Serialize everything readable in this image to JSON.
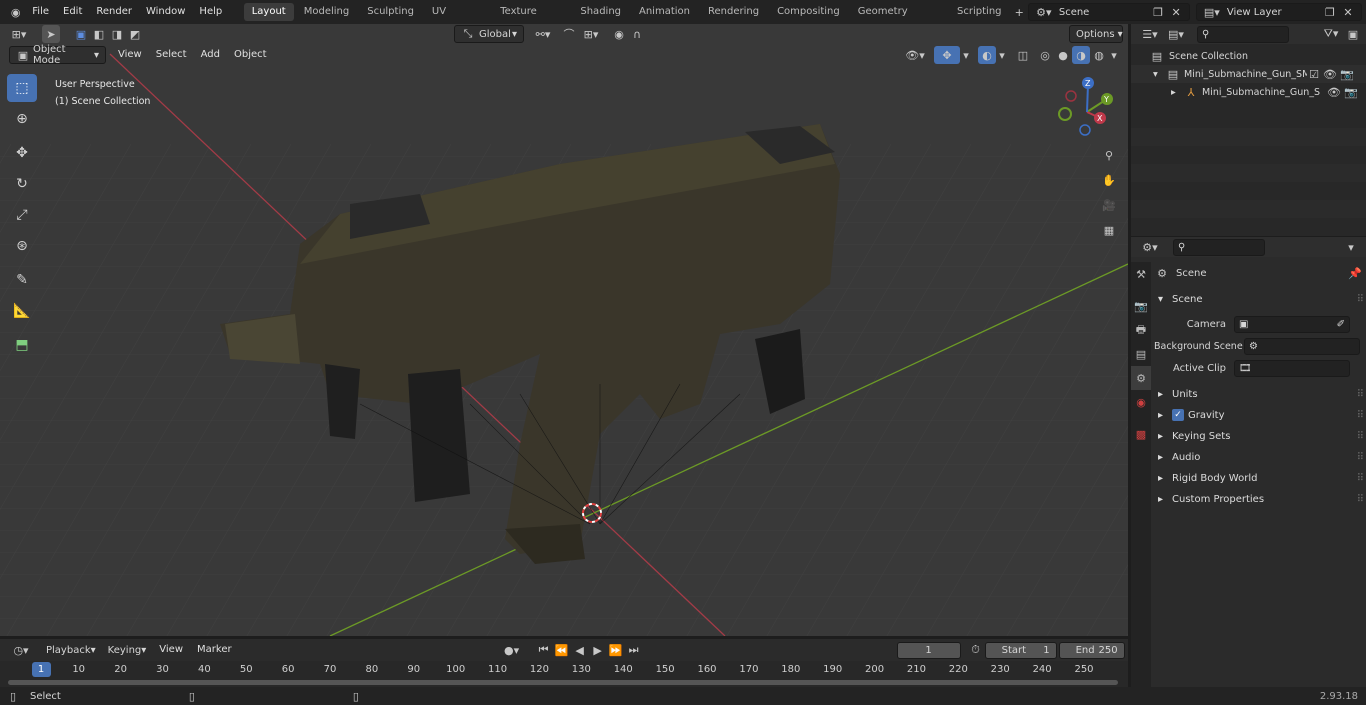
{
  "app": {
    "version": "2.93.18"
  },
  "menus": [
    "File",
    "Edit",
    "Render",
    "Window",
    "Help"
  ],
  "workspaces": [
    "Layout",
    "Modeling",
    "Sculpting",
    "UV Editing",
    "Texture Paint",
    "Shading",
    "Animation",
    "Rendering",
    "Compositing",
    "Geometry Nodes",
    "Scripting"
  ],
  "active_workspace": "Layout",
  "scene_selector": "Scene",
  "view_layer": "View Layer",
  "viewport_header": {
    "mode": "Object Mode",
    "menus": [
      "View",
      "Select",
      "Add",
      "Object"
    ],
    "transform_orientation": "Global",
    "options": "Options"
  },
  "viewport": {
    "perspective": "User Perspective",
    "collection": "(1) Scene Collection"
  },
  "gizmo": {
    "x": "X",
    "y": "Y",
    "z": "Z"
  },
  "outliner": {
    "root": "Scene Collection",
    "items": [
      {
        "label": "Mini_Submachine_Gun_SMG_S"
      },
      {
        "label": "Mini_Submachine_Gun_S"
      }
    ]
  },
  "properties": {
    "title": "Scene",
    "section": "Scene",
    "fields": [
      {
        "label": "Camera"
      },
      {
        "label": "Background Scene"
      },
      {
        "label": "Active Clip"
      }
    ],
    "panels": [
      "Units",
      "Gravity",
      "Keying Sets",
      "Audio",
      "Rigid Body World",
      "Custom Properties"
    ]
  },
  "timeline": {
    "menus": [
      "Playback",
      "Keying",
      "View",
      "Marker"
    ],
    "current_frame": "1",
    "start_label": "Start",
    "start": "1",
    "end_label": "End",
    "end": "250",
    "ticks": [
      "1",
      "10",
      "20",
      "30",
      "40",
      "50",
      "60",
      "70",
      "80",
      "90",
      "100",
      "110",
      "120",
      "130",
      "140",
      "150",
      "160",
      "170",
      "180",
      "190",
      "200",
      "210",
      "220",
      "230",
      "240",
      "250"
    ]
  },
  "status": {
    "left": "Select"
  }
}
